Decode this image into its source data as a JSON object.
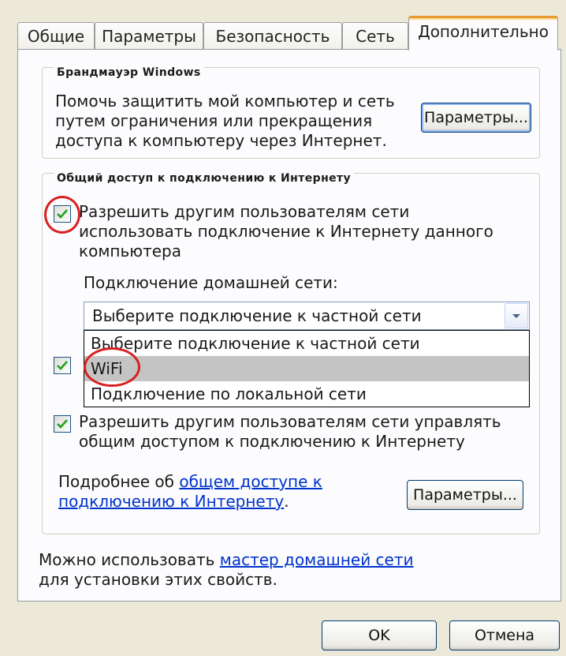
{
  "tabs": [
    {
      "label": "Общие",
      "active": false
    },
    {
      "label": "Параметры",
      "active": false
    },
    {
      "label": "Безопасность",
      "active": false
    },
    {
      "label": "Сеть",
      "active": false
    },
    {
      "label": "Дополнительно",
      "active": true
    }
  ],
  "firewall": {
    "legend": "Брандмауэр Windows",
    "description": "Помочь защитить мой компьютер и сеть путем ограничения или прекращения доступа к компьютеру через Интернет.",
    "settings_button": "Параметры..."
  },
  "ics": {
    "legend": "Общий доступ к подключению к Интернету",
    "allow_share": {
      "label": "Разрешить другим пользователям сети использовать подключение к Интернету данного компьютера",
      "checked": true
    },
    "home_network_label": "Подключение домашней сети:",
    "combo_value": "Выберите подключение к частной сети",
    "dropdown_options": [
      "Выберите подключение к частной сети",
      "WiFi",
      "Подключение по локальной сети"
    ],
    "selected_option_index": 1,
    "hidden_checkbox_checked": true,
    "allow_control": {
      "label": "Разрешить другим пользователям сети управлять общим доступом к подключению к Интернету",
      "checked": true
    },
    "more_info_prefix": "Подробнее об ",
    "more_info_link": "общем доступе к подключению к Интернету",
    "more_info_suffix": ".",
    "settings_button": "Параметры..."
  },
  "wizard": {
    "prefix": "Можно использовать ",
    "link": "мастер домашней сети",
    "suffix": " для установки этих свойств."
  },
  "footer": {
    "ok_button": "OK",
    "cancel_button": "Отмена"
  },
  "colors": {
    "annotation": "#d92020",
    "active_tab_accent": "#e69b32",
    "link": "#0033cc"
  }
}
